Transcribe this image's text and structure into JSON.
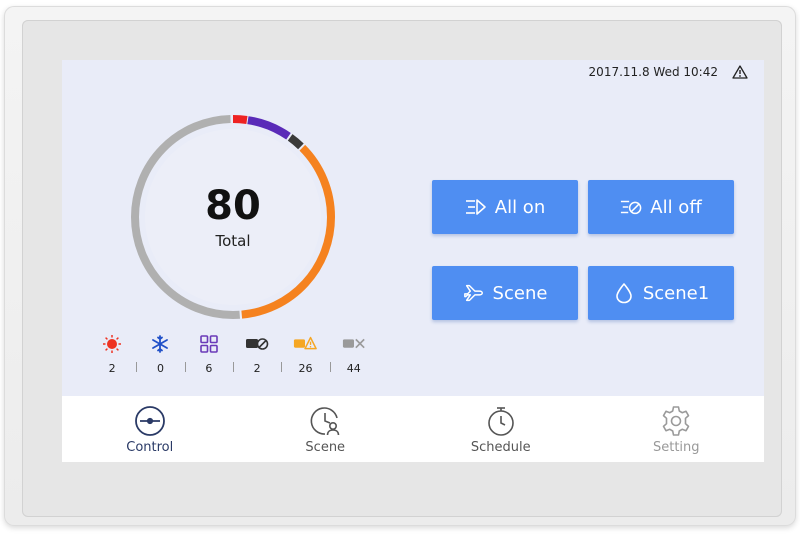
{
  "status": {
    "datetime": "2017.11.8 Wed 10:42",
    "alert_icon": "warning-icon"
  },
  "gauge": {
    "value": "80",
    "label": "Total",
    "colors": {
      "red": "#ee2222",
      "purple": "#5a2bb8",
      "dark": "#3a3a3a",
      "orange": "#f5821f",
      "gray": "#b0b0b0"
    }
  },
  "stats": [
    {
      "icon": "heat-icon",
      "value": "2",
      "color": "#ee3322"
    },
    {
      "icon": "snowflake-icon",
      "value": "0",
      "color": "#2050c8"
    },
    {
      "icon": "grid-icon",
      "value": "6",
      "color": "#6a3ab8"
    },
    {
      "icon": "device-off-icon",
      "value": "2",
      "color": "#333333"
    },
    {
      "icon": "device-warning-icon",
      "value": "26",
      "color": "#f5a623"
    },
    {
      "icon": "device-offline-icon",
      "value": "44",
      "color": "#9a9a9a"
    }
  ],
  "actions": {
    "all_on": "All on",
    "all_off": "All off",
    "scene": "Scene",
    "scene1": "Scene1",
    "color": "#4f8ef2"
  },
  "nav": {
    "control": "Control",
    "scene": "Scene",
    "schedule": "Schedule",
    "setting": "Setting"
  }
}
